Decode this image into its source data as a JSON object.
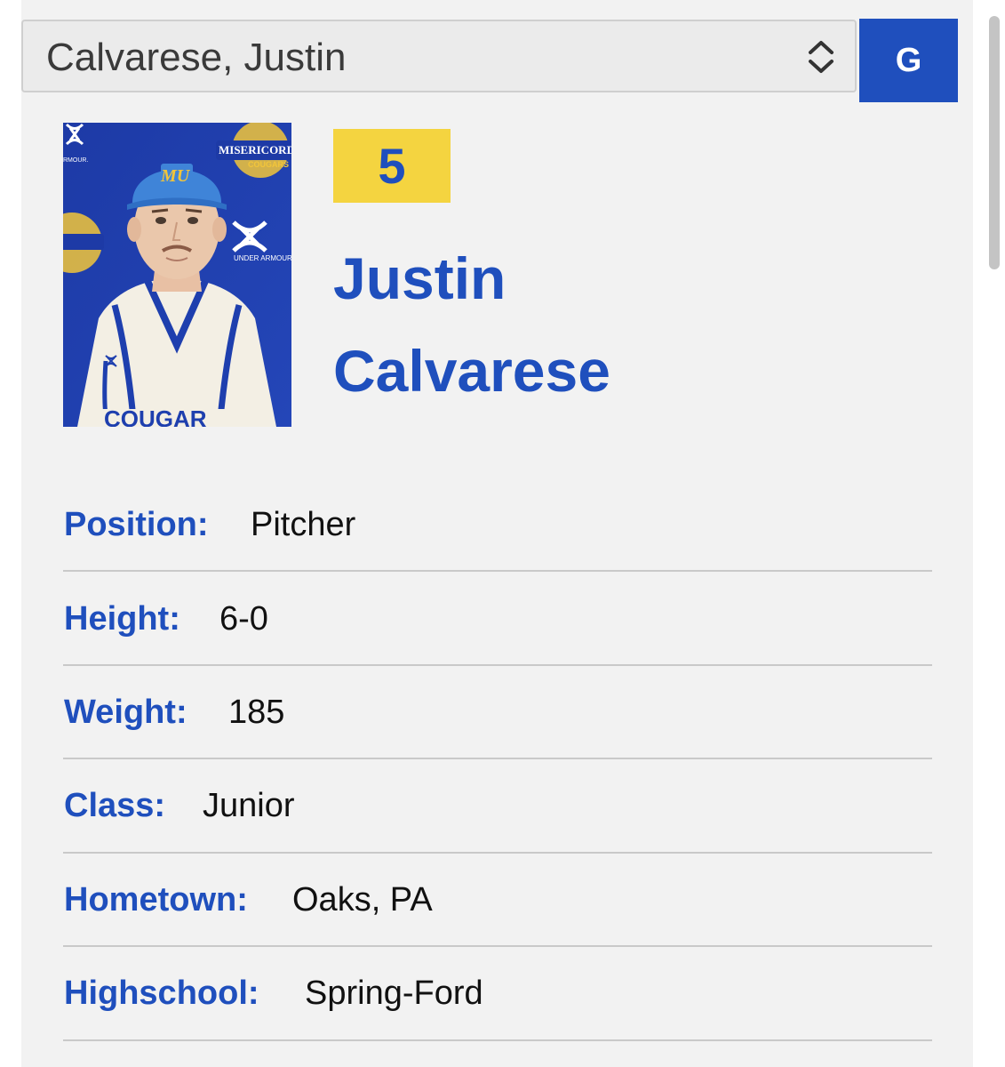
{
  "player_select": {
    "selected": "Calvarese, Justin"
  },
  "go_button": {
    "label": "G"
  },
  "colors": {
    "accent_blue": "#1f4fbd",
    "badge_yellow": "#f4d440",
    "panel_bg": "#f2f2f2"
  },
  "player": {
    "number": "5",
    "first_name": "Justin",
    "last_name": "Calvarese",
    "photo_text": {
      "brand": "UNDER ARMOUR",
      "team_top": "MISERICORDIA",
      "team_bottom": "COUGARS",
      "cap_letters": "MU"
    }
  },
  "details": [
    {
      "label": "Position:",
      "value": "Pitcher"
    },
    {
      "label": "Height:",
      "value": "6-0"
    },
    {
      "label": "Weight:",
      "value": "185"
    },
    {
      "label": "Class:",
      "value": "Junior"
    },
    {
      "label": "Hometown:",
      "value": "Oaks, PA"
    },
    {
      "label": "Highschool:",
      "value": "Spring-Ford"
    }
  ]
}
